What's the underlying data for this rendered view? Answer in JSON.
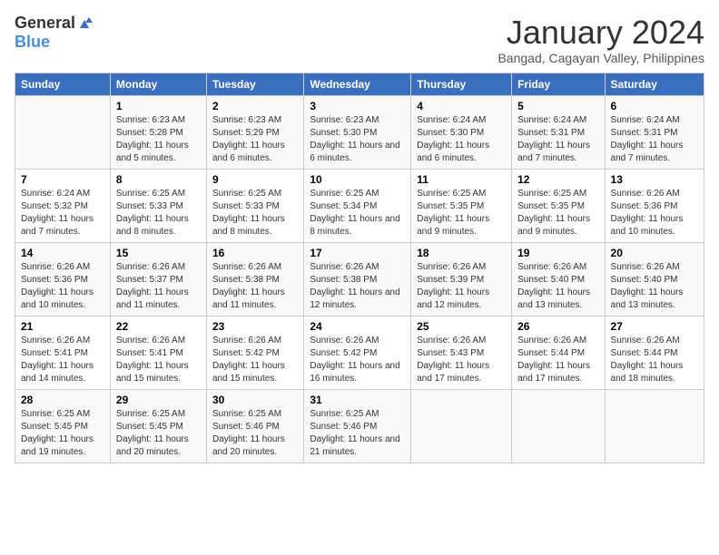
{
  "logo": {
    "general": "General",
    "blue": "Blue"
  },
  "calendar": {
    "title": "January 2024",
    "subtitle": "Bangad, Cagayan Valley, Philippines"
  },
  "headers": [
    "Sunday",
    "Monday",
    "Tuesday",
    "Wednesday",
    "Thursday",
    "Friday",
    "Saturday"
  ],
  "weeks": [
    [
      {
        "day": "",
        "sunrise": "",
        "sunset": "",
        "daylight": ""
      },
      {
        "day": "1",
        "sunrise": "Sunrise: 6:23 AM",
        "sunset": "Sunset: 5:28 PM",
        "daylight": "Daylight: 11 hours and 5 minutes."
      },
      {
        "day": "2",
        "sunrise": "Sunrise: 6:23 AM",
        "sunset": "Sunset: 5:29 PM",
        "daylight": "Daylight: 11 hours and 6 minutes."
      },
      {
        "day": "3",
        "sunrise": "Sunrise: 6:23 AM",
        "sunset": "Sunset: 5:30 PM",
        "daylight": "Daylight: 11 hours and 6 minutes."
      },
      {
        "day": "4",
        "sunrise": "Sunrise: 6:24 AM",
        "sunset": "Sunset: 5:30 PM",
        "daylight": "Daylight: 11 hours and 6 minutes."
      },
      {
        "day": "5",
        "sunrise": "Sunrise: 6:24 AM",
        "sunset": "Sunset: 5:31 PM",
        "daylight": "Daylight: 11 hours and 7 minutes."
      },
      {
        "day": "6",
        "sunrise": "Sunrise: 6:24 AM",
        "sunset": "Sunset: 5:31 PM",
        "daylight": "Daylight: 11 hours and 7 minutes."
      }
    ],
    [
      {
        "day": "7",
        "sunrise": "Sunrise: 6:24 AM",
        "sunset": "Sunset: 5:32 PM",
        "daylight": "Daylight: 11 hours and 7 minutes."
      },
      {
        "day": "8",
        "sunrise": "Sunrise: 6:25 AM",
        "sunset": "Sunset: 5:33 PM",
        "daylight": "Daylight: 11 hours and 8 minutes."
      },
      {
        "day": "9",
        "sunrise": "Sunrise: 6:25 AM",
        "sunset": "Sunset: 5:33 PM",
        "daylight": "Daylight: 11 hours and 8 minutes."
      },
      {
        "day": "10",
        "sunrise": "Sunrise: 6:25 AM",
        "sunset": "Sunset: 5:34 PM",
        "daylight": "Daylight: 11 hours and 8 minutes."
      },
      {
        "day": "11",
        "sunrise": "Sunrise: 6:25 AM",
        "sunset": "Sunset: 5:35 PM",
        "daylight": "Daylight: 11 hours and 9 minutes."
      },
      {
        "day": "12",
        "sunrise": "Sunrise: 6:25 AM",
        "sunset": "Sunset: 5:35 PM",
        "daylight": "Daylight: 11 hours and 9 minutes."
      },
      {
        "day": "13",
        "sunrise": "Sunrise: 6:26 AM",
        "sunset": "Sunset: 5:36 PM",
        "daylight": "Daylight: 11 hours and 10 minutes."
      }
    ],
    [
      {
        "day": "14",
        "sunrise": "Sunrise: 6:26 AM",
        "sunset": "Sunset: 5:36 PM",
        "daylight": "Daylight: 11 hours and 10 minutes."
      },
      {
        "day": "15",
        "sunrise": "Sunrise: 6:26 AM",
        "sunset": "Sunset: 5:37 PM",
        "daylight": "Daylight: 11 hours and 11 minutes."
      },
      {
        "day": "16",
        "sunrise": "Sunrise: 6:26 AM",
        "sunset": "Sunset: 5:38 PM",
        "daylight": "Daylight: 11 hours and 11 minutes."
      },
      {
        "day": "17",
        "sunrise": "Sunrise: 6:26 AM",
        "sunset": "Sunset: 5:38 PM",
        "daylight": "Daylight: 11 hours and 12 minutes."
      },
      {
        "day": "18",
        "sunrise": "Sunrise: 6:26 AM",
        "sunset": "Sunset: 5:39 PM",
        "daylight": "Daylight: 11 hours and 12 minutes."
      },
      {
        "day": "19",
        "sunrise": "Sunrise: 6:26 AM",
        "sunset": "Sunset: 5:40 PM",
        "daylight": "Daylight: 11 hours and 13 minutes."
      },
      {
        "day": "20",
        "sunrise": "Sunrise: 6:26 AM",
        "sunset": "Sunset: 5:40 PM",
        "daylight": "Daylight: 11 hours and 13 minutes."
      }
    ],
    [
      {
        "day": "21",
        "sunrise": "Sunrise: 6:26 AM",
        "sunset": "Sunset: 5:41 PM",
        "daylight": "Daylight: 11 hours and 14 minutes."
      },
      {
        "day": "22",
        "sunrise": "Sunrise: 6:26 AM",
        "sunset": "Sunset: 5:41 PM",
        "daylight": "Daylight: 11 hours and 15 minutes."
      },
      {
        "day": "23",
        "sunrise": "Sunrise: 6:26 AM",
        "sunset": "Sunset: 5:42 PM",
        "daylight": "Daylight: 11 hours and 15 minutes."
      },
      {
        "day": "24",
        "sunrise": "Sunrise: 6:26 AM",
        "sunset": "Sunset: 5:42 PM",
        "daylight": "Daylight: 11 hours and 16 minutes."
      },
      {
        "day": "25",
        "sunrise": "Sunrise: 6:26 AM",
        "sunset": "Sunset: 5:43 PM",
        "daylight": "Daylight: 11 hours and 17 minutes."
      },
      {
        "day": "26",
        "sunrise": "Sunrise: 6:26 AM",
        "sunset": "Sunset: 5:44 PM",
        "daylight": "Daylight: 11 hours and 17 minutes."
      },
      {
        "day": "27",
        "sunrise": "Sunrise: 6:26 AM",
        "sunset": "Sunset: 5:44 PM",
        "daylight": "Daylight: 11 hours and 18 minutes."
      }
    ],
    [
      {
        "day": "28",
        "sunrise": "Sunrise: 6:25 AM",
        "sunset": "Sunset: 5:45 PM",
        "daylight": "Daylight: 11 hours and 19 minutes."
      },
      {
        "day": "29",
        "sunrise": "Sunrise: 6:25 AM",
        "sunset": "Sunset: 5:45 PM",
        "daylight": "Daylight: 11 hours and 20 minutes."
      },
      {
        "day": "30",
        "sunrise": "Sunrise: 6:25 AM",
        "sunset": "Sunset: 5:46 PM",
        "daylight": "Daylight: 11 hours and 20 minutes."
      },
      {
        "day": "31",
        "sunrise": "Sunrise: 6:25 AM",
        "sunset": "Sunset: 5:46 PM",
        "daylight": "Daylight: 11 hours and 21 minutes."
      },
      {
        "day": "",
        "sunrise": "",
        "sunset": "",
        "daylight": ""
      },
      {
        "day": "",
        "sunrise": "",
        "sunset": "",
        "daylight": ""
      },
      {
        "day": "",
        "sunrise": "",
        "sunset": "",
        "daylight": ""
      }
    ]
  ]
}
